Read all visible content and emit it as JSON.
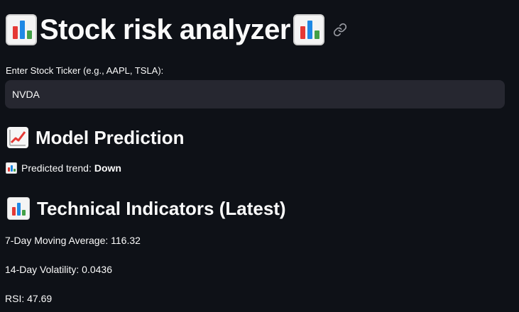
{
  "app": {
    "title": "Stock risk analyzer"
  },
  "ticker_input": {
    "label": "Enter Stock Ticker (e.g., AAPL, TSLA):",
    "value": "NVDA"
  },
  "prediction": {
    "heading": "Model Prediction",
    "trend_label": "Predicted trend:",
    "trend_value": "Down"
  },
  "indicators": {
    "heading": "Technical Indicators (Latest)",
    "moving_average": "7-Day Moving Average: 116.32",
    "volatility": "14-Day Volatility: 0.0436",
    "rsi": "RSI: 47.69"
  },
  "icons": {
    "title_left": "bar-chart-icon",
    "title_right": "bar-chart-icon",
    "anchor": "link-icon",
    "prediction": "chart-increasing-icon",
    "trend": "bar-chart-icon",
    "indicators": "bar-chart-icon"
  },
  "colors": {
    "background": "#0e1117",
    "input_background": "#262730",
    "text": "#fafafa"
  }
}
